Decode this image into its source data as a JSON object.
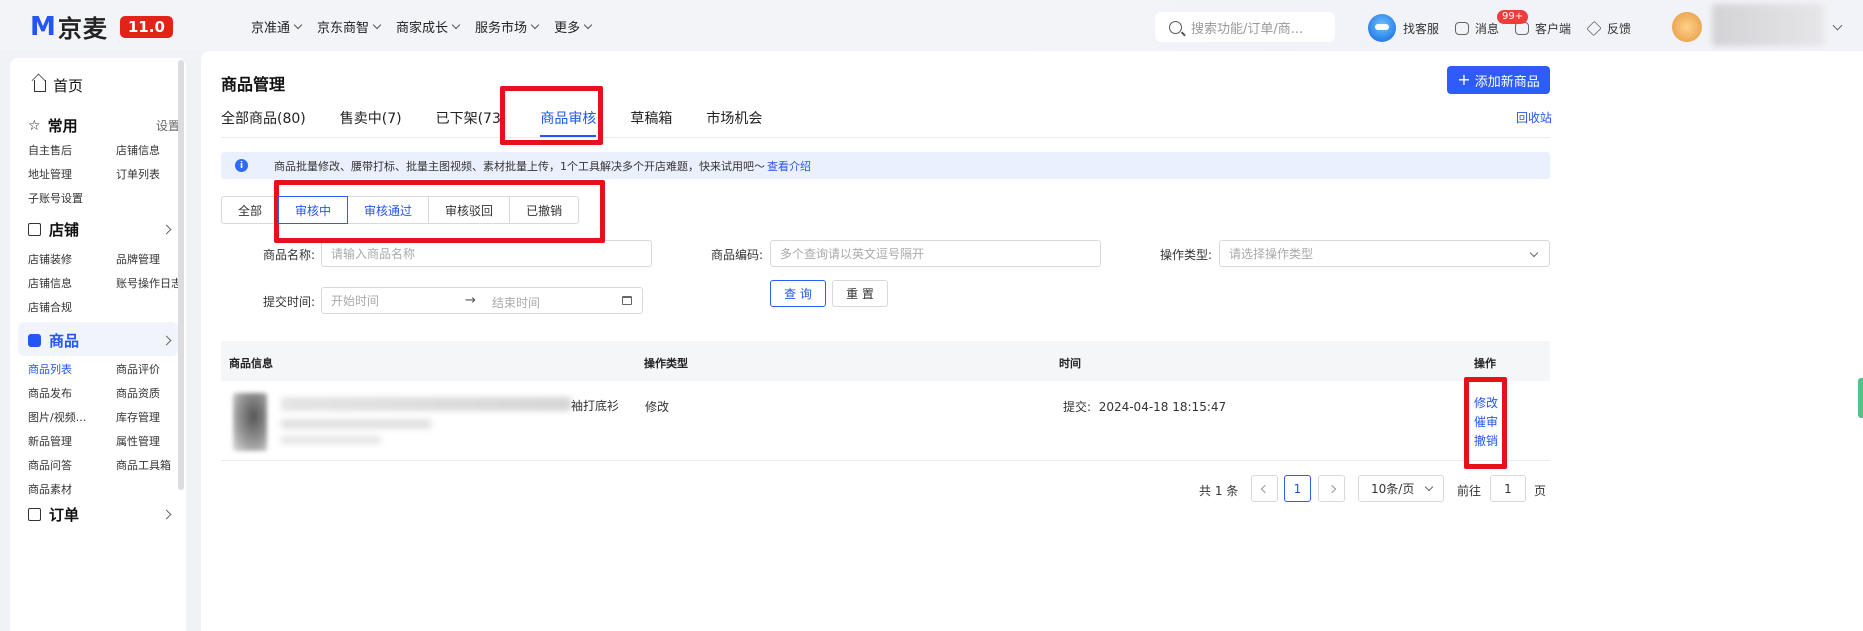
{
  "brand": {
    "logo_m": "M",
    "name": "京麦",
    "version": "11.0"
  },
  "topnav": [
    {
      "label": "京准通"
    },
    {
      "label": "京东商智"
    },
    {
      "label": "商家成长"
    },
    {
      "label": "服务市场"
    },
    {
      "label": "更多"
    }
  ],
  "top_search": {
    "placeholder": "搜索功能/订单/商..."
  },
  "top_tools": {
    "service": "找客服",
    "messages": "消息",
    "messages_badge": "99+",
    "client": "客户端",
    "feedback": "反馈"
  },
  "sidebar": {
    "home": "首页",
    "common": {
      "title": "常用",
      "action": "设置",
      "items": [
        "自主售后",
        "店铺信息",
        "地址管理",
        "订单列表",
        "子账号设置"
      ]
    },
    "shop": {
      "title": "店铺",
      "items": [
        "店铺装修",
        "品牌管理",
        "店铺信息",
        "账号操作日志",
        "店铺合规"
      ]
    },
    "goods": {
      "title": "商品",
      "items": [
        "商品列表",
        "商品评价",
        "商品发布",
        "商品资质",
        "图片/视频...",
        "库存管理",
        "新品管理",
        "属性管理",
        "商品问答",
        "商品工具箱",
        "商品素材"
      ]
    },
    "orders": {
      "title": "订单"
    }
  },
  "main": {
    "title": "商品管理",
    "add_button": "添加新商品",
    "recycle": "回收站",
    "tabs": [
      "全部商品(80)",
      "售卖中(7)",
      "已下架(73)",
      "商品审核",
      "草稿箱",
      "市场机会"
    ],
    "active_tab": 3,
    "info": {
      "text": "商品批量修改、腰带打标、批量主图视频、素材批量上传，1个工具解决多个开店难题，快来试用吧～",
      "link": "查看介绍"
    },
    "status_tabs": [
      "全部",
      "审核中",
      "审核通过",
      "审核驳回",
      "已撤销"
    ],
    "form": {
      "name_label": "商品名称:",
      "name_placeholder": "请输入商品名称",
      "code_label": "商品编码:",
      "code_placeholder": "多个查询请以英文逗号隔开",
      "optype_label": "操作类型:",
      "optype_placeholder": "请选择操作类型",
      "time_label": "提交时间:",
      "start_placeholder": "开始时间",
      "arrow": "→",
      "end_placeholder": "结束时间",
      "query_btn": "查 询",
      "reset_btn": "重 置"
    },
    "table": {
      "headers": {
        "info": "商品信息",
        "optype": "操作类型",
        "time": "时间",
        "ops": "操作"
      },
      "rows": [
        {
          "name_tail": "袖打底衫",
          "optype": "修改",
          "time_label": "提交:",
          "time": "2024-04-18 18:15:47",
          "actions": [
            "修改",
            "催审",
            "撤销"
          ]
        }
      ]
    },
    "pagination": {
      "total": "共 1 条",
      "current": "1",
      "page_size": "10条/页",
      "goto_label": "前往",
      "goto_value": "1",
      "page_unit": "页"
    }
  },
  "colors": {
    "accent": "#2456f5",
    "highlight": "#e8101a",
    "brand_red": "#e2231a"
  }
}
